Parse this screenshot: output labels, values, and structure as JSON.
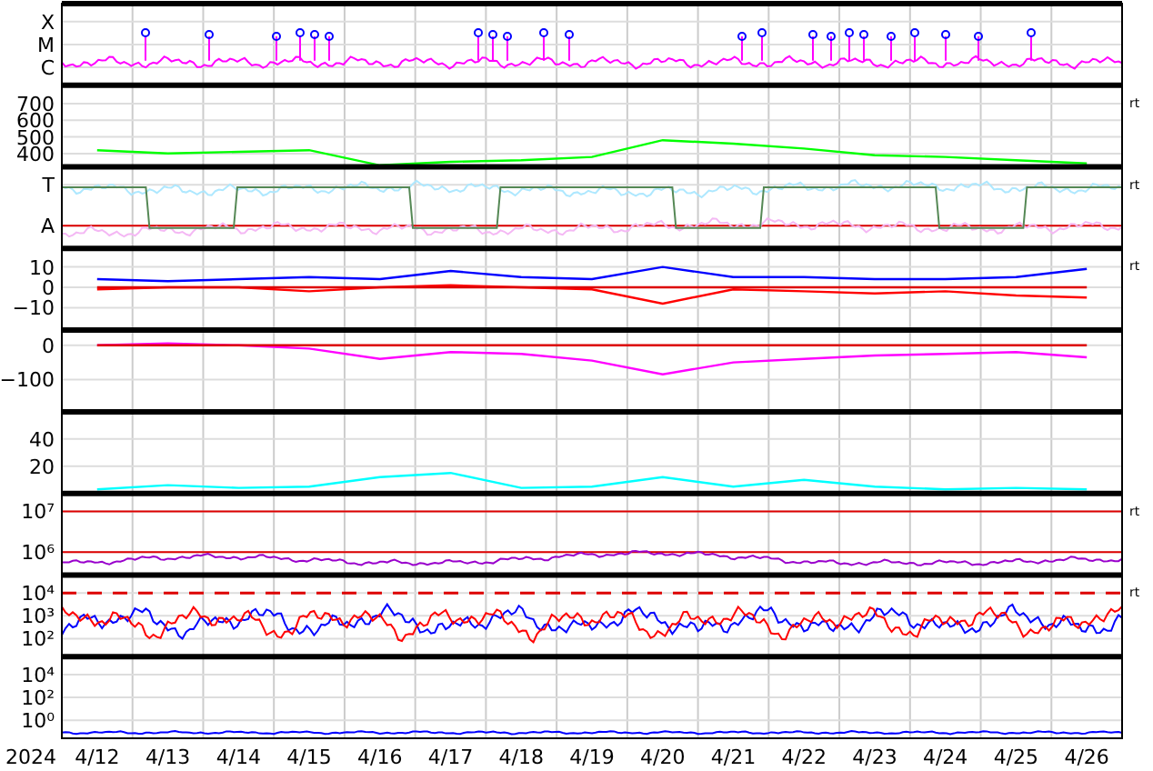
{
  "panels": [
    {
      "ticks": [
        {
          "label": "X"
        },
        {
          "label": "M"
        },
        {
          "label": "C"
        }
      ],
      "traces": [
        {
          "color": "#ff00ff",
          "kind": "flare"
        }
      ]
    },
    {
      "side_label": "rt",
      "chart_data": {
        "type": "line",
        "grid": true,
        "categories": [
          null,
          null,
          null,
          null,
          null,
          null,
          null,
          null,
          null,
          null,
          null,
          null,
          null,
          null,
          null
        ],
        "ylim": [
          320,
          810
        ],
        "yticks": [
          700,
          600,
          500,
          400
        ],
        "series": [
          {
            "color": "#00ff00",
            "values": [
              420,
              400,
              410,
              420,
              330,
              350,
              360,
              380,
              480,
              460,
              430,
              390,
              380,
              360,
              340
            ]
          }
        ]
      }
    },
    {
      "side_label": "rt",
      "ticks": [
        {
          "label": "T"
        },
        {
          "label": "A",
          "ref_line": true
        }
      ],
      "traces": [
        {
          "color": "#aee8ff",
          "kind": "noise"
        },
        {
          "color": "#f4b8f4",
          "kind": "noise"
        },
        {
          "color": "#558855",
          "kind": "step"
        }
      ]
    },
    {
      "side_label": "rt",
      "chart_data": {
        "type": "line",
        "grid": true,
        "categories": [
          null,
          null,
          null,
          null,
          null,
          null,
          null,
          null,
          null,
          null,
          null,
          null,
          null,
          null,
          null
        ],
        "ylim": [
          -21,
          19
        ],
        "yticks": [
          {
            "value": 10,
            "label": "10"
          },
          {
            "value": 0,
            "label": "0"
          },
          {
            "value": -10,
            "label": "−10"
          }
        ],
        "series": [
          {
            "color": "#0000ff",
            "values": [
              4,
              3,
              4,
              5,
              4,
              8,
              5,
              4,
              10,
              5,
              5,
              4,
              4,
              5,
              9
            ]
          },
          {
            "color": "#ff0000",
            "values": [
              -1,
              0,
              0,
              -2,
              0,
              1,
              0,
              -1,
              -8,
              -1,
              -2,
              -3,
              -2,
              -4,
              -5
            ]
          },
          {
            "color": "#dd0000",
            "values": [
              0,
              0,
              0,
              0,
              0,
              0,
              0,
              0,
              0,
              0,
              0,
              0,
              0,
              0,
              0
            ]
          }
        ]
      }
    },
    {
      "chart_data": {
        "type": "line",
        "grid": true,
        "categories": [
          null,
          null,
          null,
          null,
          null,
          null,
          null,
          null,
          null,
          null,
          null,
          null,
          null,
          null,
          null
        ],
        "ylim": [
          -194,
          44
        ],
        "yticks": [
          {
            "value": 0,
            "label": "0"
          },
          {
            "value": -100,
            "label": "−100"
          }
        ],
        "series": [
          {
            "color": "#ff00ff",
            "values": [
              0,
              5,
              0,
              -10,
              -40,
              -20,
              -25,
              -45,
              -85,
              -50,
              -40,
              -30,
              -25,
              -20,
              -35
            ]
          },
          {
            "color": "#dd0000",
            "values": [
              0,
              0,
              0,
              0,
              0,
              0,
              0,
              0,
              0,
              0,
              0,
              0,
              0,
              0,
              0
            ]
          }
        ]
      }
    },
    {
      "chart_data": {
        "type": "line",
        "grid": true,
        "categories": [
          null,
          null,
          null,
          null,
          null,
          null,
          null,
          null,
          null,
          null,
          null,
          null,
          null,
          null,
          null
        ],
        "ylim": [
          0,
          60
        ],
        "yticks": [
          40,
          20
        ],
        "series": [
          {
            "color": "#00ffff",
            "values": [
              3,
              6,
              4,
              5,
              12,
              15,
              4,
              5,
              12,
              5,
              10,
              5,
              3,
              4,
              3
            ]
          }
        ]
      }
    },
    {
      "side_label": "rt",
      "ticks": [
        {
          "label": "10⁷",
          "ref_line": true
        },
        {
          "label": "10⁶",
          "ref_line": true
        }
      ],
      "traces": [
        {
          "color": "#9900cc",
          "kind": "low"
        }
      ]
    },
    {
      "side_label": "rt",
      "ticks": [
        {
          "label": "10⁴",
          "ref_line": true,
          "dashed": true
        },
        {
          "label": "10³"
        },
        {
          "label": "10²"
        }
      ],
      "traces": [
        {
          "color": "#0000ff",
          "kind": "arch"
        },
        {
          "color": "#ff0000",
          "kind": "arch"
        }
      ]
    },
    {
      "ticks": [
        {
          "label": "10⁴"
        },
        {
          "label": "10²"
        },
        {
          "label": "10⁰"
        }
      ],
      "traces": [
        {
          "color": "#0000ff",
          "kind": "floor"
        }
      ]
    }
  ],
  "x_axis": {
    "year": "2024",
    "labels": [
      "4/12",
      "4/13",
      "4/14",
      "4/15",
      "4/16",
      "4/17",
      "4/18",
      "4/19",
      "4/20",
      "4/21",
      "4/22",
      "4/23",
      "4/24",
      "4/25",
      "4/26"
    ]
  }
}
